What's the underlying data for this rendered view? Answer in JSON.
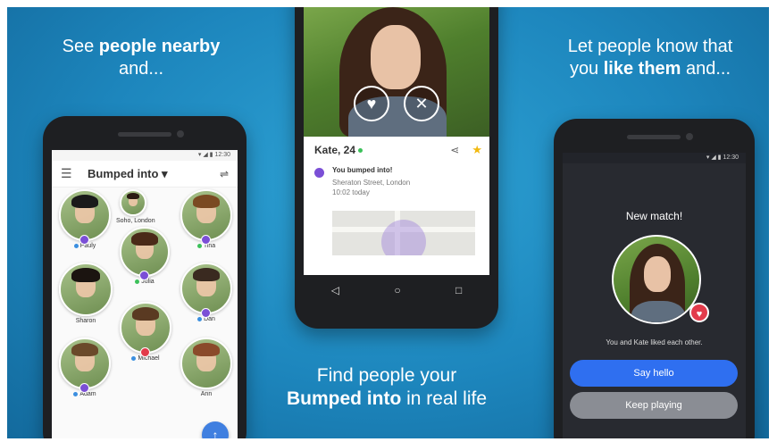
{
  "captions": {
    "left_plain": "See ",
    "left_bold": "people nearby",
    "left_end": "and...",
    "right_line1": "Let people know that",
    "right_plain": "you ",
    "right_bold": "like them",
    "right_end": " and...",
    "bottom_line1": "Find people your",
    "bottom_bold": "Bumped into",
    "bottom_end": " in real life"
  },
  "status_time": "12:30",
  "left_phone": {
    "title": "Bumped into",
    "menu_icon": "hamburger-icon",
    "filter_icon": "sliders-icon",
    "people": [
      {
        "label": "Soho, London",
        "hair": "#2a1b12"
      },
      {
        "label": "Pauly",
        "hair": "#1a1a1a"
      },
      {
        "label": "Tina",
        "hair": "#7a4a22"
      },
      {
        "label": "Julia",
        "hair": "#4a2a18"
      },
      {
        "label": "Sharon",
        "hair": "#1b1410"
      },
      {
        "label": "Dan",
        "hair": "#3a2a20"
      },
      {
        "label": "Michael",
        "hair": "#5a3a22"
      },
      {
        "label": "Adam",
        "hair": "#6a4a2a"
      },
      {
        "label": "Ann",
        "hair": "#8a4a2a"
      }
    ],
    "fab_icon": "arrow-up-icon"
  },
  "center_phone": {
    "like_icon": "heart-icon",
    "dismiss_icon": "close-icon",
    "name": "Kate, 24",
    "share_icon": "share-icon",
    "star_icon": "star-icon",
    "bump_title": "You bumped into!",
    "bump_place": "Sheraton Street, London",
    "bump_time": "10:02 today"
  },
  "right_phone": {
    "title": "New match!",
    "text": "You and Kate liked each other.",
    "hello_button": "Say hello",
    "keep_button": "Keep playing"
  }
}
